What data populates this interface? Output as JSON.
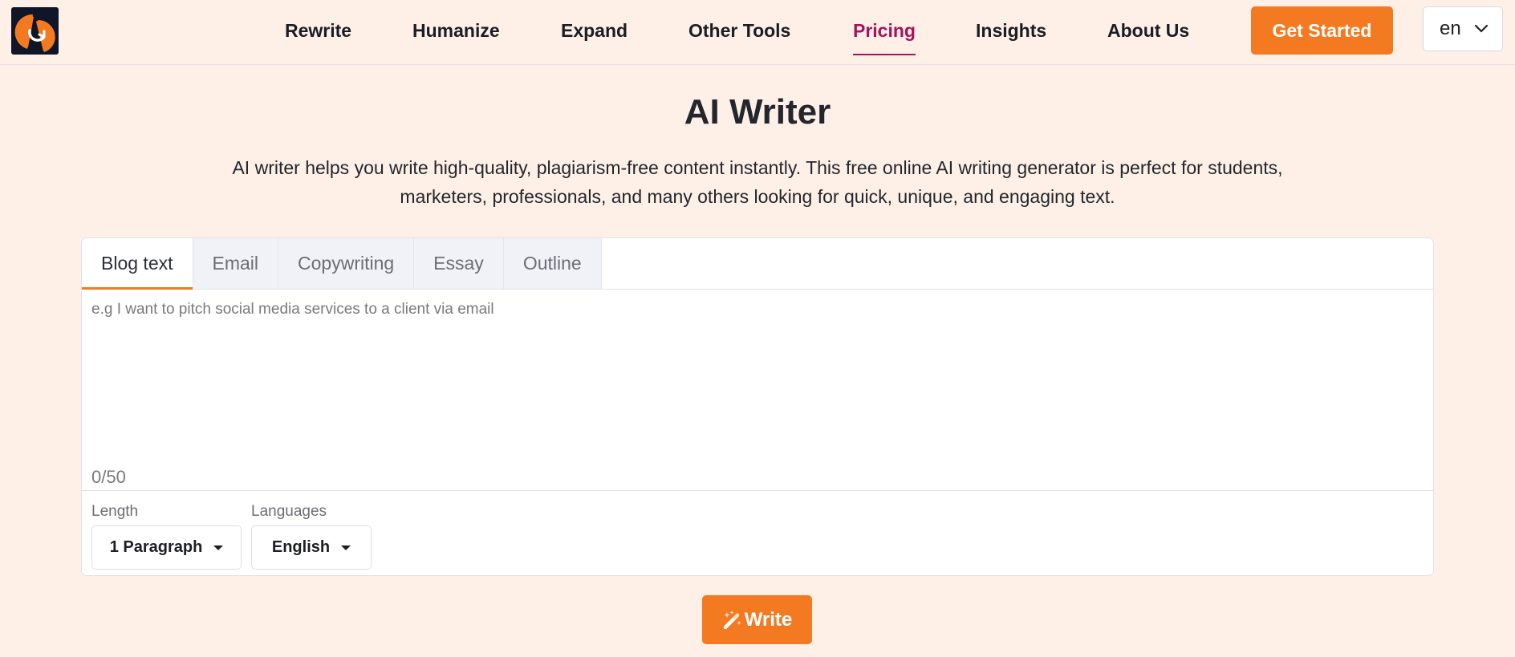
{
  "header": {
    "logo_alt": "logo",
    "nav": [
      {
        "label": "Rewrite",
        "active": false
      },
      {
        "label": "Humanize",
        "active": false
      },
      {
        "label": "Expand",
        "active": false
      },
      {
        "label": "Other Tools",
        "active": false
      },
      {
        "label": "Pricing",
        "active": true
      },
      {
        "label": "Insights",
        "active": false
      },
      {
        "label": "About Us",
        "active": false
      }
    ],
    "cta_label": "Get Started",
    "language": "en"
  },
  "hero": {
    "title": "AI Writer",
    "description_line1": "AI writer helps you write high-quality, plagiarism-free content instantly. This free online AI writing generator is perfect for students,",
    "description_line2": "marketers, professionals, and many others looking for quick, unique, and engaging text."
  },
  "editor": {
    "tabs": [
      {
        "label": "Blog text",
        "active": true
      },
      {
        "label": "Email",
        "active": false
      },
      {
        "label": "Copywriting",
        "active": false
      },
      {
        "label": "Essay",
        "active": false
      },
      {
        "label": "Outline",
        "active": false
      }
    ],
    "input_value": "",
    "placeholder": "e.g I want to pitch social media services to a client via email",
    "counter": "0/50",
    "length_label": "Length",
    "length_value": "1 Paragraph",
    "languages_label": "Languages",
    "languages_value": "English"
  },
  "write_button_label": "Write",
  "colors": {
    "accent": "#f47a22",
    "active_nav": "#a5125e",
    "background": "#fef0e7"
  }
}
